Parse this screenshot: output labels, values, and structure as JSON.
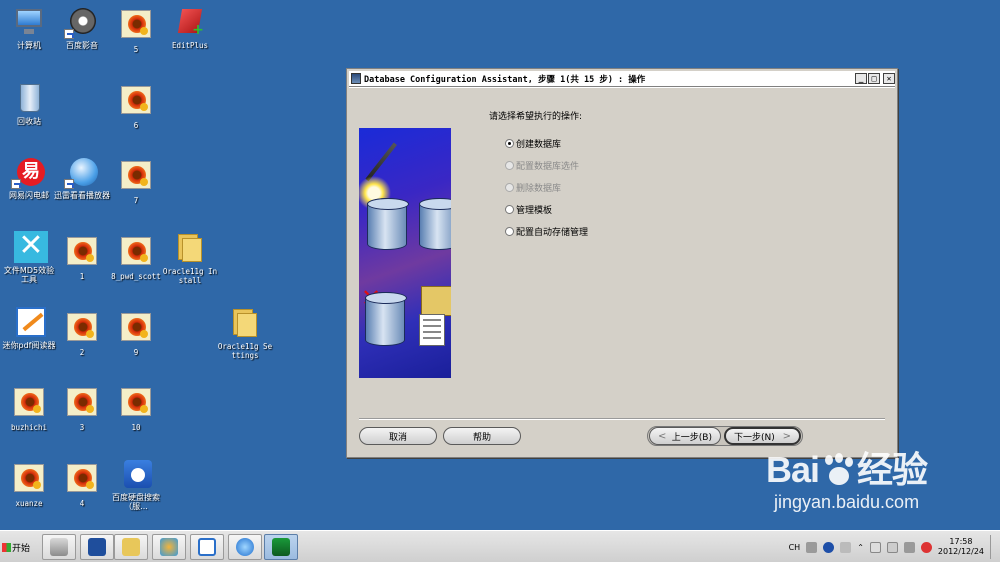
{
  "desktop": {
    "icons": [
      {
        "label": "计算机"
      },
      {
        "label": "百度影音"
      },
      {
        "label": "5"
      },
      {
        "label": "EditPlus"
      },
      {
        "label": "回收站"
      },
      {
        "label": "6"
      },
      {
        "label": "网易闪电邮"
      },
      {
        "label": "迅雷看看播放器"
      },
      {
        "label": "7"
      },
      {
        "label": "文件MD5效验工具"
      },
      {
        "label": "1"
      },
      {
        "label": "8_pwd_scott"
      },
      {
        "label": "Oracle11g Install"
      },
      {
        "label": "迷你pdf阅读器"
      },
      {
        "label": "2"
      },
      {
        "label": "9"
      },
      {
        "label": "Oracle11g Settings"
      },
      {
        "label": "buzhichi"
      },
      {
        "label": "3"
      },
      {
        "label": "10"
      },
      {
        "label": "xuanze"
      },
      {
        "label": "4"
      },
      {
        "label": "百度硬盘搜索（服..."
      }
    ]
  },
  "dialog": {
    "title": "Database Configuration Assistant, 步骤 1(共 15 步) : 操作",
    "prompt": "请选择希望执行的操作:",
    "options": [
      {
        "label": "创建数据库",
        "selected": true,
        "enabled": true
      },
      {
        "label": "配置数据库选件",
        "selected": false,
        "enabled": false
      },
      {
        "label": "删除数据库",
        "selected": false,
        "enabled": false
      },
      {
        "label": "管理模板",
        "selected": false,
        "enabled": true
      },
      {
        "label": "配置自动存储管理",
        "selected": false,
        "enabled": true
      }
    ],
    "buttons": {
      "cancel": "取消",
      "help": "帮助",
      "back": "上一步(B)",
      "next": "下一步(N)"
    }
  },
  "watermark": {
    "brand_left": "Bai",
    "brand_right": "经验",
    "url": "jingyan.baidu.com"
  },
  "taskbar": {
    "start_label": "开始",
    "language": "CH",
    "time": "17:58",
    "date": "2012/12/24"
  },
  "colors": {
    "desktop": "#2f68a8",
    "dialog": "#d4d0c8"
  }
}
